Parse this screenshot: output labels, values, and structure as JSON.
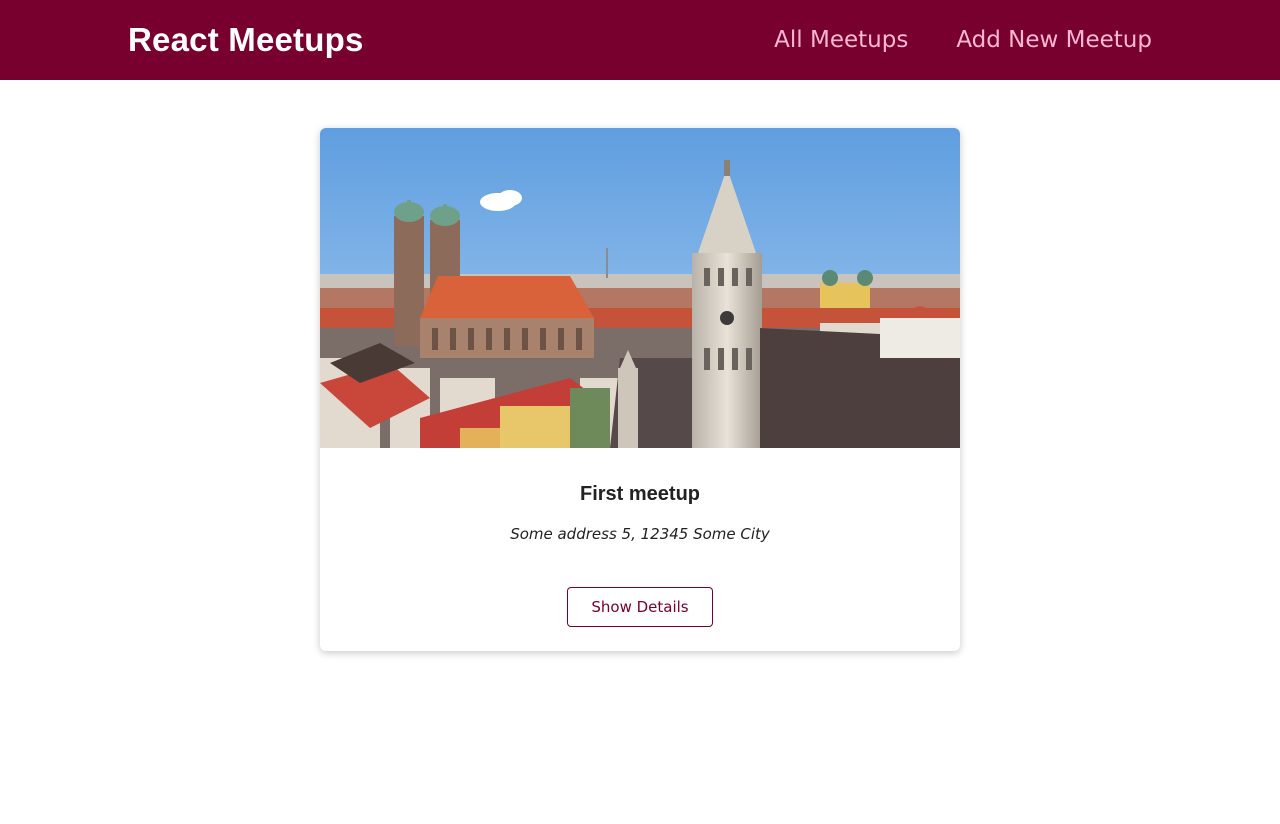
{
  "header": {
    "logo": "React Meetups",
    "nav": [
      {
        "label": "All Meetups"
      },
      {
        "label": "Add New Meetup"
      }
    ]
  },
  "meetups": [
    {
      "title": "First meetup",
      "address": "Some address 5, 12345 Some City",
      "action_label": "Show Details",
      "image_alt": "First meetup"
    }
  ],
  "colors": {
    "brand": "#77002e",
    "nav_link": "#fcb8d2",
    "text": "#222222"
  }
}
